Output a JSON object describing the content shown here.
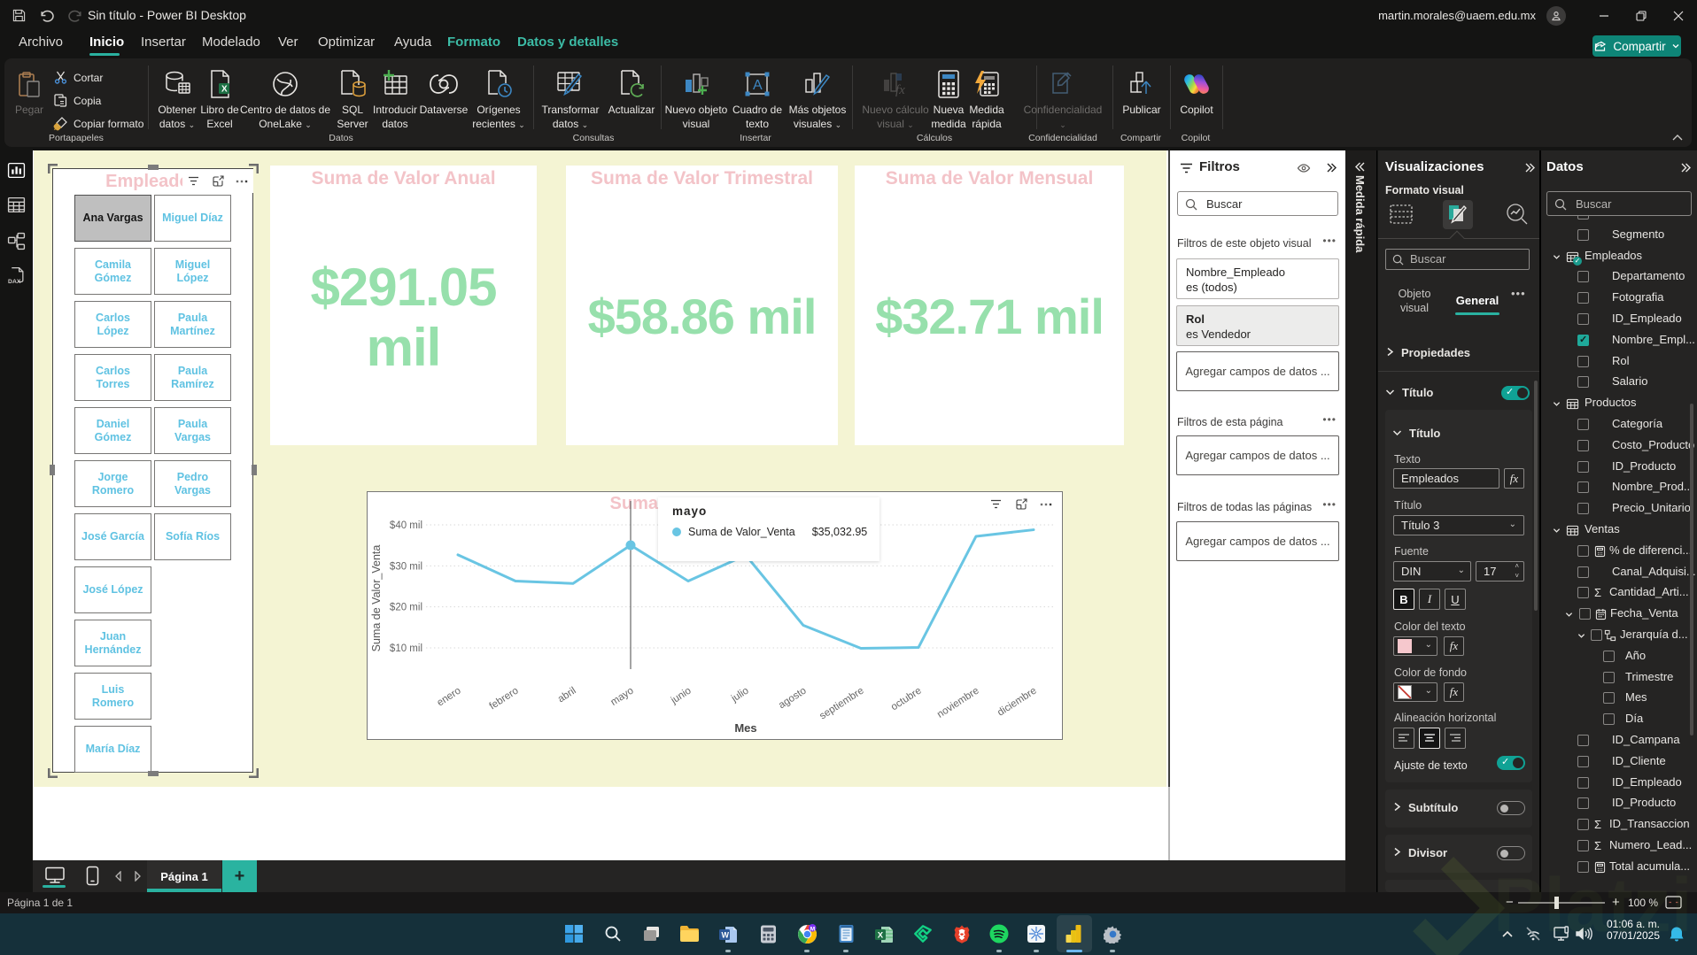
{
  "window": {
    "title": "Sin título - Power BI Desktop",
    "user_email": "martin.morales@uaem.edu.mx"
  },
  "menu": {
    "items": [
      "Archivo",
      "Inicio",
      "Insertar",
      "Modelado",
      "Ver",
      "Optimizar",
      "Ayuda",
      "Formato",
      "Datos y detalles"
    ],
    "active_item": "Inicio",
    "share_label": "Compartir"
  },
  "ribbon": {
    "clipboard": {
      "group": "Portapapeles",
      "paste": "Pegar",
      "cut": "Cortar",
      "copy": "Copia",
      "format_painter": "Copiar formato"
    },
    "data": {
      "group": "Datos",
      "get_data_1": "Obtener",
      "get_data_2": "datos",
      "excel_1": "Libro de",
      "excel_2": "Excel",
      "onelake_1": "Centro de datos de",
      "onelake_2": "OneLake",
      "sql_1": "SQL",
      "sql_2": "Server",
      "enter_1": "Introducir",
      "enter_2": "datos",
      "dataverse": "Dataverse",
      "recent_1": "Orígenes",
      "recent_2": "recientes"
    },
    "queries": {
      "group": "Consultas",
      "transform_1": "Transformar",
      "transform_2": "datos",
      "refresh": "Actualizar"
    },
    "insert": {
      "group": "Insertar",
      "new_visual_1": "Nuevo objeto",
      "new_visual_2": "visual",
      "textbox_1": "Cuadro de",
      "textbox_2": "texto",
      "more_visuals_1": "Más objetos",
      "more_visuals_2": "visuales"
    },
    "calculations": {
      "group": "Cálculos",
      "new_calc_1": "Nuevo cálculo",
      "new_calc_2": "visual",
      "new_measure_1": "Nueva",
      "new_measure_2": "medida",
      "quick_measure_1": "Medida",
      "quick_measure_2": "rápida"
    },
    "sensitivity": {
      "group": "Confidencialidad",
      "button": "Confidencialidad"
    },
    "share": {
      "group": "Compartir",
      "publish": "Publicar"
    },
    "copilot": {
      "group": "Copilot",
      "button": "Copilot"
    }
  },
  "canvas": {
    "slicer": {
      "title": "Empleados",
      "items": [
        {
          "label": "Ana Vargas",
          "selected": true,
          "wrap": false
        },
        {
          "label": "Miguel Díaz",
          "selected": false,
          "wrap": false
        },
        {
          "label": "Camila Gómez",
          "selected": false,
          "wrap": true
        },
        {
          "label": "Miguel López",
          "selected": false,
          "wrap": true
        },
        {
          "label": "Carlos López",
          "selected": false,
          "wrap": true
        },
        {
          "label": "Paula Martínez",
          "selected": false,
          "wrap": true
        },
        {
          "label": "Carlos Torres",
          "selected": false,
          "wrap": true
        },
        {
          "label": "Paula Ramírez",
          "selected": false,
          "wrap": true
        },
        {
          "label": "Daniel Gómez",
          "selected": false,
          "wrap": true
        },
        {
          "label": "Paula Vargas",
          "selected": false,
          "wrap": true
        },
        {
          "label": "Jorge Romero",
          "selected": false,
          "wrap": true
        },
        {
          "label": "Pedro Vargas",
          "selected": false,
          "wrap": true
        },
        {
          "label": "José García",
          "selected": false,
          "wrap": false
        },
        {
          "label": "Sofía Ríos",
          "selected": false,
          "wrap": false
        },
        {
          "label": "José López",
          "selected": false,
          "wrap": false
        },
        {
          "label": "Juan Hernández",
          "selected": false,
          "wrap": true
        },
        {
          "label": "Luis Romero",
          "selected": false,
          "wrap": true
        },
        {
          "label": "María Díaz",
          "selected": false,
          "wrap": false
        }
      ]
    },
    "cards": [
      {
        "title": "Suma de Valor Anual",
        "value": "$291.05 mil"
      },
      {
        "title": "Suma de Valor Trimestral",
        "value": "$58.86 mil"
      },
      {
        "title": "Suma de Valor Mensual",
        "value": "$32.71 mil"
      }
    ]
  },
  "chart_data": {
    "type": "line",
    "title_visible": "Suma",
    "x": [
      "enero",
      "febrero",
      "abril",
      "mayo",
      "junio",
      "julio",
      "agosto",
      "septiembre",
      "octubre",
      "noviembre",
      "diciembre"
    ],
    "series": [
      {
        "name": "Suma de Valor_Venta",
        "values": [
          32700,
          26300,
          25700,
          35032.95,
          26300,
          32600,
          15500,
          9900,
          10100,
          37200,
          38800
        ]
      }
    ],
    "xlabel": "Mes",
    "ylabel": "Suma de Valor_Venta",
    "yticks": [
      {
        "value": 10000,
        "label": "$10 mil"
      },
      {
        "value": 20000,
        "label": "$20 mil"
      },
      {
        "value": 30000,
        "label": "$30 mil"
      },
      {
        "value": 40000,
        "label": "$40 mil"
      }
    ],
    "ylim": [
      2000,
      42000
    ],
    "grid": true,
    "line_color": "#69c5e3",
    "highlight_index": 3,
    "tooltip": {
      "title": "mayo",
      "series": "Suma de Valor_Venta",
      "value": "$35,032.95"
    }
  },
  "filters": {
    "title": "Filtros",
    "search_placeholder": "Buscar",
    "section_visual": "Filtros de este objeto visual",
    "section_page": "Filtros de esta página",
    "section_all_pages": "Filtros de todas las páginas",
    "add_fields": "Agregar campos de datos ...",
    "cards": [
      {
        "field": "Nombre_Empleado",
        "condition": "es (todos)",
        "shaded": false
      },
      {
        "field": "Rol",
        "condition": "es Vendedor",
        "shaded": true
      }
    ]
  },
  "quick_measure_pane": {
    "label": "Medida rápida"
  },
  "visualizations": {
    "title": "Visualizaciones",
    "subtitle": "Formato visual",
    "search_placeholder": "Buscar",
    "tab_visual_1": "Objeto",
    "tab_visual_2": "visual",
    "tab_general": "General",
    "properties": "Propiedades",
    "section_title": "Título",
    "inner_title": "Título",
    "text_label": "Texto",
    "text_value": "Empleados",
    "fx": "fx",
    "title_style_label": "Título",
    "title_style_value": "Título 3",
    "font_label": "Fuente",
    "font_value": "DIN",
    "font_size": "17",
    "bold": "B",
    "italic": "I",
    "underline": "U",
    "text_color_label": "Color del texto",
    "text_color": "#f6c8cd",
    "bg_color_label": "Color de fondo",
    "align_label": "Alineación horizontal",
    "wrap_label": "Ajuste de texto",
    "subtitle_section": "Subtítulo",
    "divider_section": "Divisor"
  },
  "fields_panel": {
    "title": "Datos",
    "search_placeholder": "Buscar",
    "rows": [
      {
        "label": "Segmento",
        "indent": 1,
        "type": "field"
      },
      {
        "label": "Empleados",
        "indent": 0,
        "type": "table",
        "badge": true
      },
      {
        "label": "Departamento",
        "indent": 1,
        "type": "field"
      },
      {
        "label": "Fotografia",
        "indent": 1,
        "type": "field"
      },
      {
        "label": "ID_Empleado",
        "indent": 1,
        "type": "field"
      },
      {
        "label": "Nombre_Empl...",
        "indent": 1,
        "type": "field",
        "checked": true
      },
      {
        "label": "Rol",
        "indent": 1,
        "type": "field"
      },
      {
        "label": "Salario",
        "indent": 1,
        "type": "field"
      },
      {
        "label": "Productos",
        "indent": 0,
        "type": "table"
      },
      {
        "label": "Categoría",
        "indent": 1,
        "type": "field"
      },
      {
        "label": "Costo_Producto",
        "indent": 1,
        "type": "field"
      },
      {
        "label": "ID_Producto",
        "indent": 1,
        "type": "field"
      },
      {
        "label": "Nombre_Prod...",
        "indent": 1,
        "type": "field"
      },
      {
        "label": "Precio_Unitario",
        "indent": 1,
        "type": "field"
      },
      {
        "label": "Ventas",
        "indent": 0,
        "type": "table"
      },
      {
        "label": "% de diferenci...",
        "indent": 1,
        "type": "measure"
      },
      {
        "label": "Canal_Adquisi...",
        "indent": 1,
        "type": "field"
      },
      {
        "label": "Cantidad_Arti...",
        "indent": 1,
        "type": "sum"
      },
      {
        "label": "Fecha_Venta",
        "indent": 1,
        "type": "date"
      },
      {
        "label": "Jerarquía d...",
        "indent": 2,
        "type": "hierarchy"
      },
      {
        "label": "Año",
        "indent": 3,
        "type": "field"
      },
      {
        "label": "Trimestre",
        "indent": 3,
        "type": "field"
      },
      {
        "label": "Mes",
        "indent": 3,
        "type": "field"
      },
      {
        "label": "Día",
        "indent": 3,
        "type": "field"
      },
      {
        "label": "ID_Campana",
        "indent": 1,
        "type": "field"
      },
      {
        "label": "ID_Cliente",
        "indent": 1,
        "type": "field"
      },
      {
        "label": "ID_Empleado",
        "indent": 1,
        "type": "field"
      },
      {
        "label": "ID_Producto",
        "indent": 1,
        "type": "field"
      },
      {
        "label": "ID_Transaccion",
        "indent": 1,
        "type": "sum"
      },
      {
        "label": "Numero_Lead...",
        "indent": 1,
        "type": "sum"
      },
      {
        "label": "Total acumula...",
        "indent": 1,
        "type": "measure"
      }
    ]
  },
  "page_bar": {
    "page": "Página 1"
  },
  "status_bar": {
    "left": "Página 1 de 1",
    "zoom": "100 %"
  },
  "taskbar": {
    "time": "01:06 a. m.",
    "date": "07/01/2025"
  },
  "watermark": {
    "brand": "Platzi",
    "color": "#97c93d"
  }
}
